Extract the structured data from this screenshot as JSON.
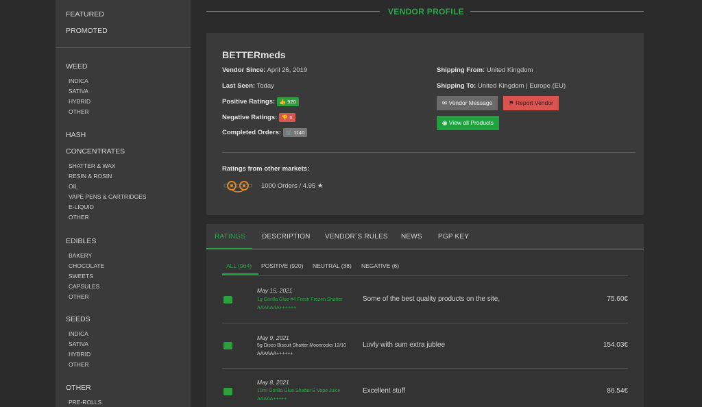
{
  "sidebar": {
    "top_items": [
      "FEATURED",
      "PROMOTED"
    ],
    "groups": [
      {
        "title": "WEED",
        "items": [
          "INDICA",
          "SATIVA",
          "HYBRID",
          "OTHER"
        ]
      },
      {
        "title": "HASH",
        "items": []
      },
      {
        "title": "CONCENTRATES",
        "items": [
          "SHATTER & WAX",
          "RESIN & ROSIN",
          "OIL",
          "VAPE PENS & CARTRIDGES",
          "E-LIQUID",
          "OTHER"
        ]
      },
      {
        "title": "EDIBLES",
        "items": [
          "BAKERY",
          "CHOCOLATE",
          "SWEETS",
          "CAPSULES",
          "OTHER"
        ]
      },
      {
        "title": "SEEDS",
        "items": [
          "INDICA",
          "SATIVA",
          "HYBRID",
          "OTHER"
        ]
      },
      {
        "title": "OTHER",
        "items": [
          "PRE-ROLLS"
        ]
      }
    ]
  },
  "header": {
    "title": "VENDOR PROFILE"
  },
  "vendor": {
    "name": "BETTERmeds",
    "since_label": "Vendor Since:",
    "since_value": "April 26, 2019",
    "last_seen_label": "Last Seen:",
    "last_seen_value": "Today",
    "positive_label": "Positive Ratings:",
    "positive_value": "920",
    "negative_label": "Negative Ratings:",
    "negative_value": "6",
    "orders_label": "Completed Orders:",
    "orders_value": "1140",
    "ship_from_label": "Shipping From:",
    "ship_from_value": "United Kingdom",
    "ship_to_label": "Shipping To:",
    "ship_to_value": "United Kingdom | Europe (EU)",
    "message_button": "Vendor Message",
    "report_button": "Report Vendor",
    "products_button": "View all Products",
    "other_markets_label": "Ratings from other markets:",
    "other_markets_value": "1000 Orders / 4.95",
    "market_logo_text": "Dream Market"
  },
  "tabs": [
    "RATINGS",
    "DESCRIPTION",
    "VENDOR`S RULES",
    "NEWS",
    "PGP KEY"
  ],
  "subtabs": [
    "ALL (964)",
    "POSITIVE (920)",
    "NEUTRAL (38)",
    "NEGATIVE (6)"
  ],
  "reviews": [
    {
      "date": "May 15, 2021",
      "product": "1g Gorilla Glue #4 Fresh Frozen Shatter AAAAAAA++++++",
      "product_green": true,
      "text": "Some of the best quality products on the site,",
      "price": "75.60€"
    },
    {
      "date": "May 9, 2021",
      "product": "5g Disco Biscuit Shatter Moonrocks 12/10 AAAAAA++++++",
      "product_green": false,
      "text": "Luvly with sum extra jublee",
      "price": "154.03€"
    },
    {
      "date": "May 8, 2021",
      "product": "10ml Gorilla Glue Shatter E Vape Juice AAAAA+++++",
      "product_green": true,
      "text": "Excellent stuff",
      "price": "86.54€"
    }
  ],
  "colors": {
    "accent": "#2ca84a",
    "danger": "#d9534f",
    "panel": "#3a3a3a",
    "background": "#2b2b2b"
  }
}
